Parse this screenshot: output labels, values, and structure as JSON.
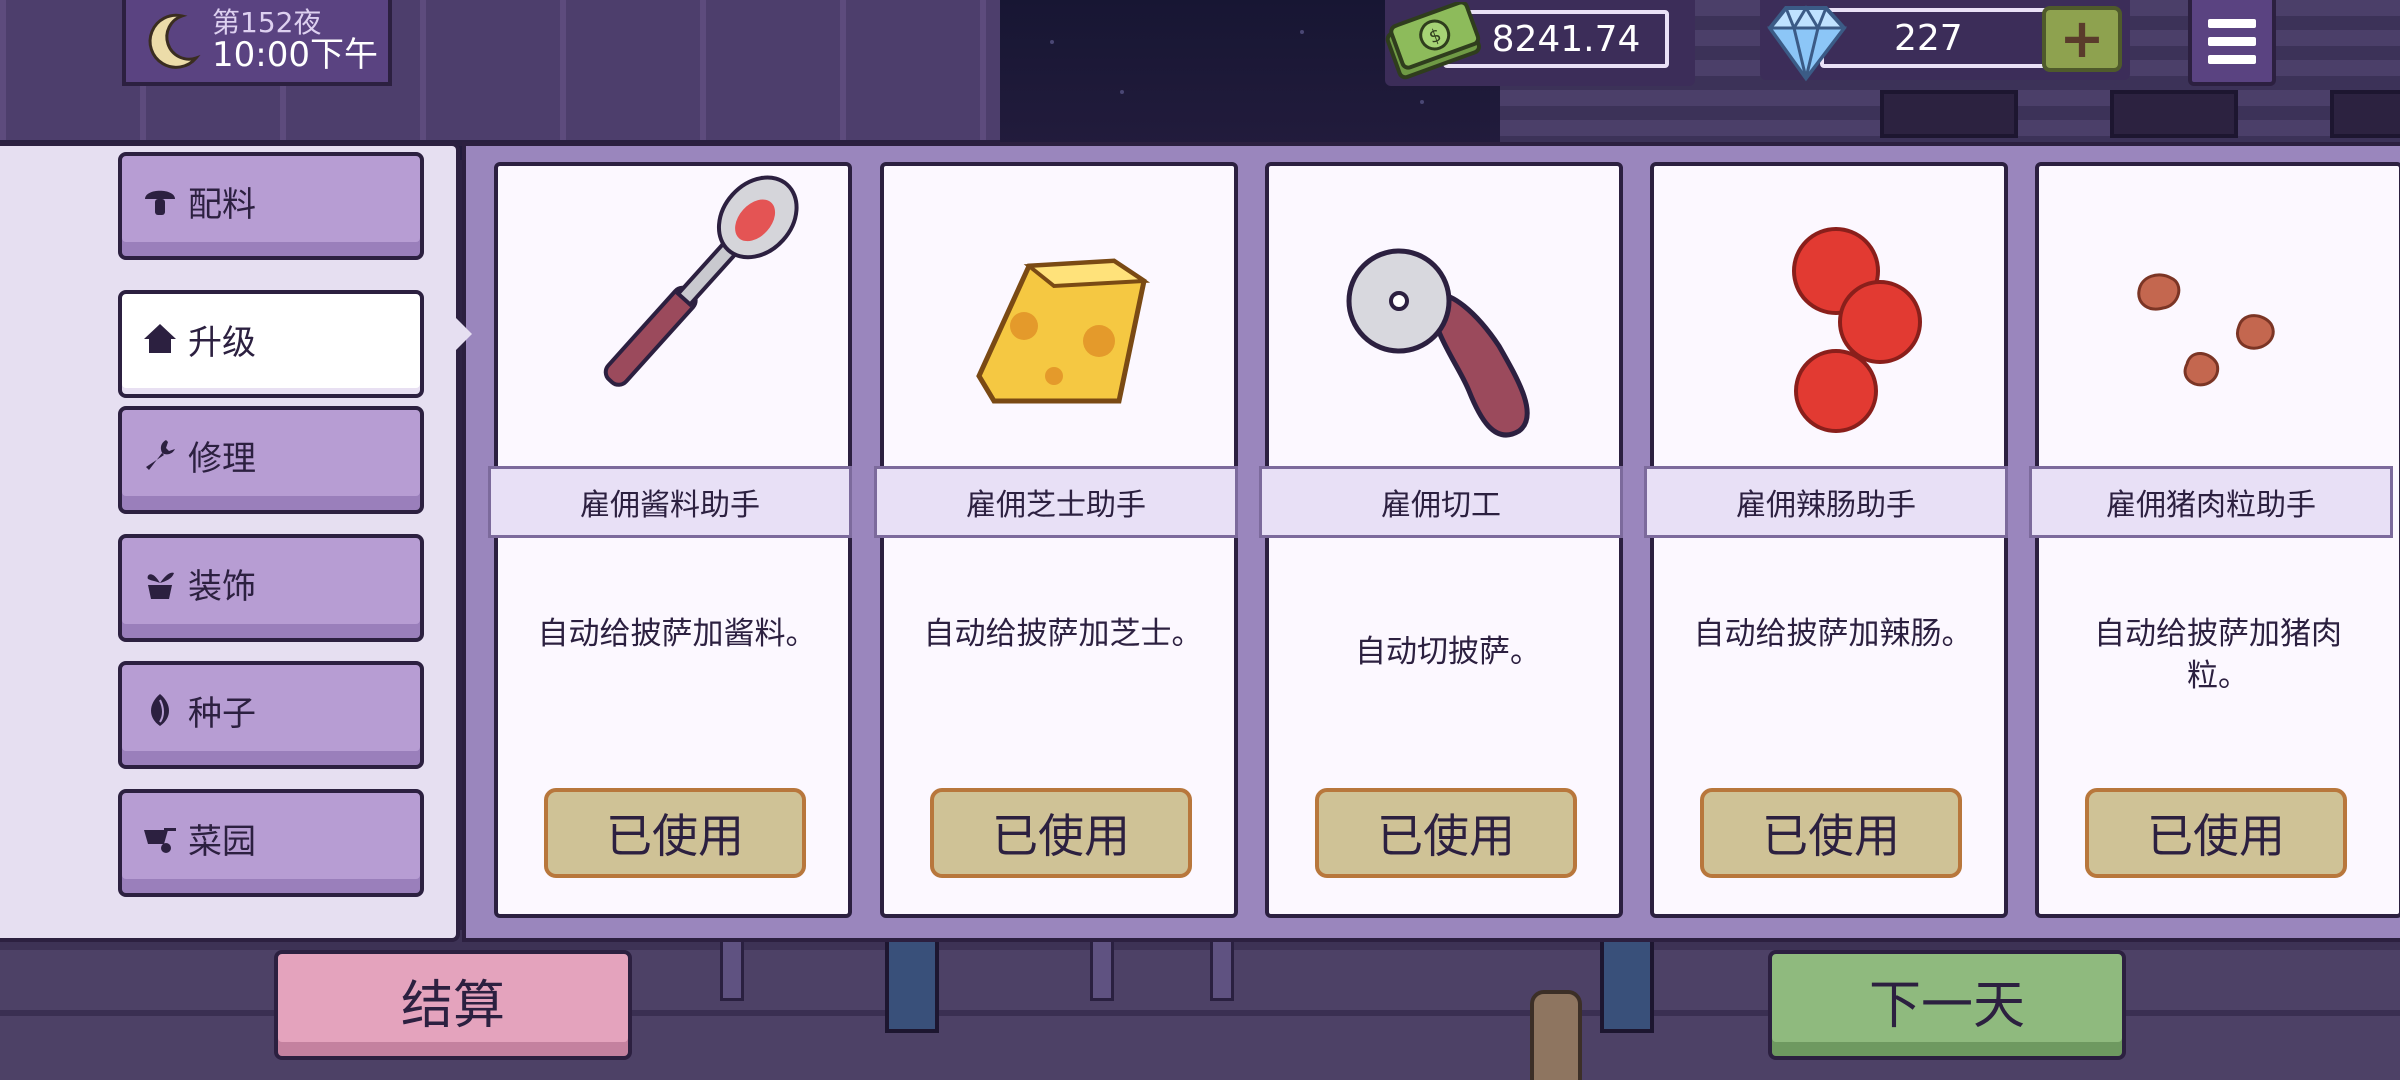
{
  "hud": {
    "night_label": "第152夜",
    "clock_label": "10:00下午",
    "money": "8241.74",
    "gems": "227",
    "plus_label": "+"
  },
  "sidebar": {
    "items": [
      {
        "label": "配料",
        "icon": "mushroom-icon",
        "active": false
      },
      {
        "label": "升级",
        "icon": "house-icon",
        "active": true
      },
      {
        "label": "修理",
        "icon": "wrench-icon",
        "active": false
      },
      {
        "label": "装饰",
        "icon": "potted-plant-icon",
        "active": false
      },
      {
        "label": "种子",
        "icon": "seed-icon",
        "active": false
      },
      {
        "label": "菜园",
        "icon": "wheelbarrow-icon",
        "active": false
      }
    ]
  },
  "cards": [
    {
      "title": "雇佣酱料助手",
      "desc": "自动给披萨加酱料。",
      "button": "已使用",
      "icon": "sauce-spoon-icon"
    },
    {
      "title": "雇佣芝士助手",
      "desc": "自动给披萨加芝士。",
      "button": "已使用",
      "icon": "cheese-icon"
    },
    {
      "title": "雇佣切工",
      "desc": "自动切披萨。",
      "button": "已使用",
      "icon": "pizza-cutter-icon"
    },
    {
      "title": "雇佣辣肠助手",
      "desc": "自动给披萨加辣肠。",
      "button": "已使用",
      "icon": "pepperoni-icon"
    },
    {
      "title": "雇佣猪肉粒助手",
      "desc": "自动给披萨加猪肉粒。",
      "button": "已使用",
      "icon": "sausage-crumbles-icon"
    }
  ],
  "footer": {
    "settle_label": "结算",
    "next_day_label": "下一天"
  },
  "colors": {
    "panel_purple": "#9a86bd",
    "button_tan": "#cfc296",
    "button_border": "#b8773c",
    "settle_pink": "#e4a3bd",
    "next_green": "#8fba7e"
  }
}
